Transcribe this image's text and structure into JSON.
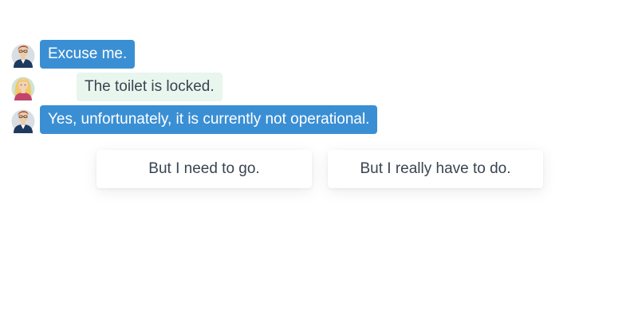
{
  "messages": [
    {
      "speaker": "user",
      "avatar": "man-avatar-icon",
      "text": "Excuse me."
    },
    {
      "speaker": "partner",
      "avatar": "woman-avatar-icon",
      "text": "The toilet is locked."
    },
    {
      "speaker": "user",
      "avatar": "man-avatar-icon",
      "text": "Yes, unfortunately, it is currently not operational."
    }
  ],
  "options": [
    {
      "label": "But I need to go."
    },
    {
      "label": "But I really have to do."
    }
  ],
  "colors": {
    "user_bubble": "#3a8fd4",
    "partner_bubble": "#e8f6ee",
    "text_dark": "#3a4452"
  }
}
